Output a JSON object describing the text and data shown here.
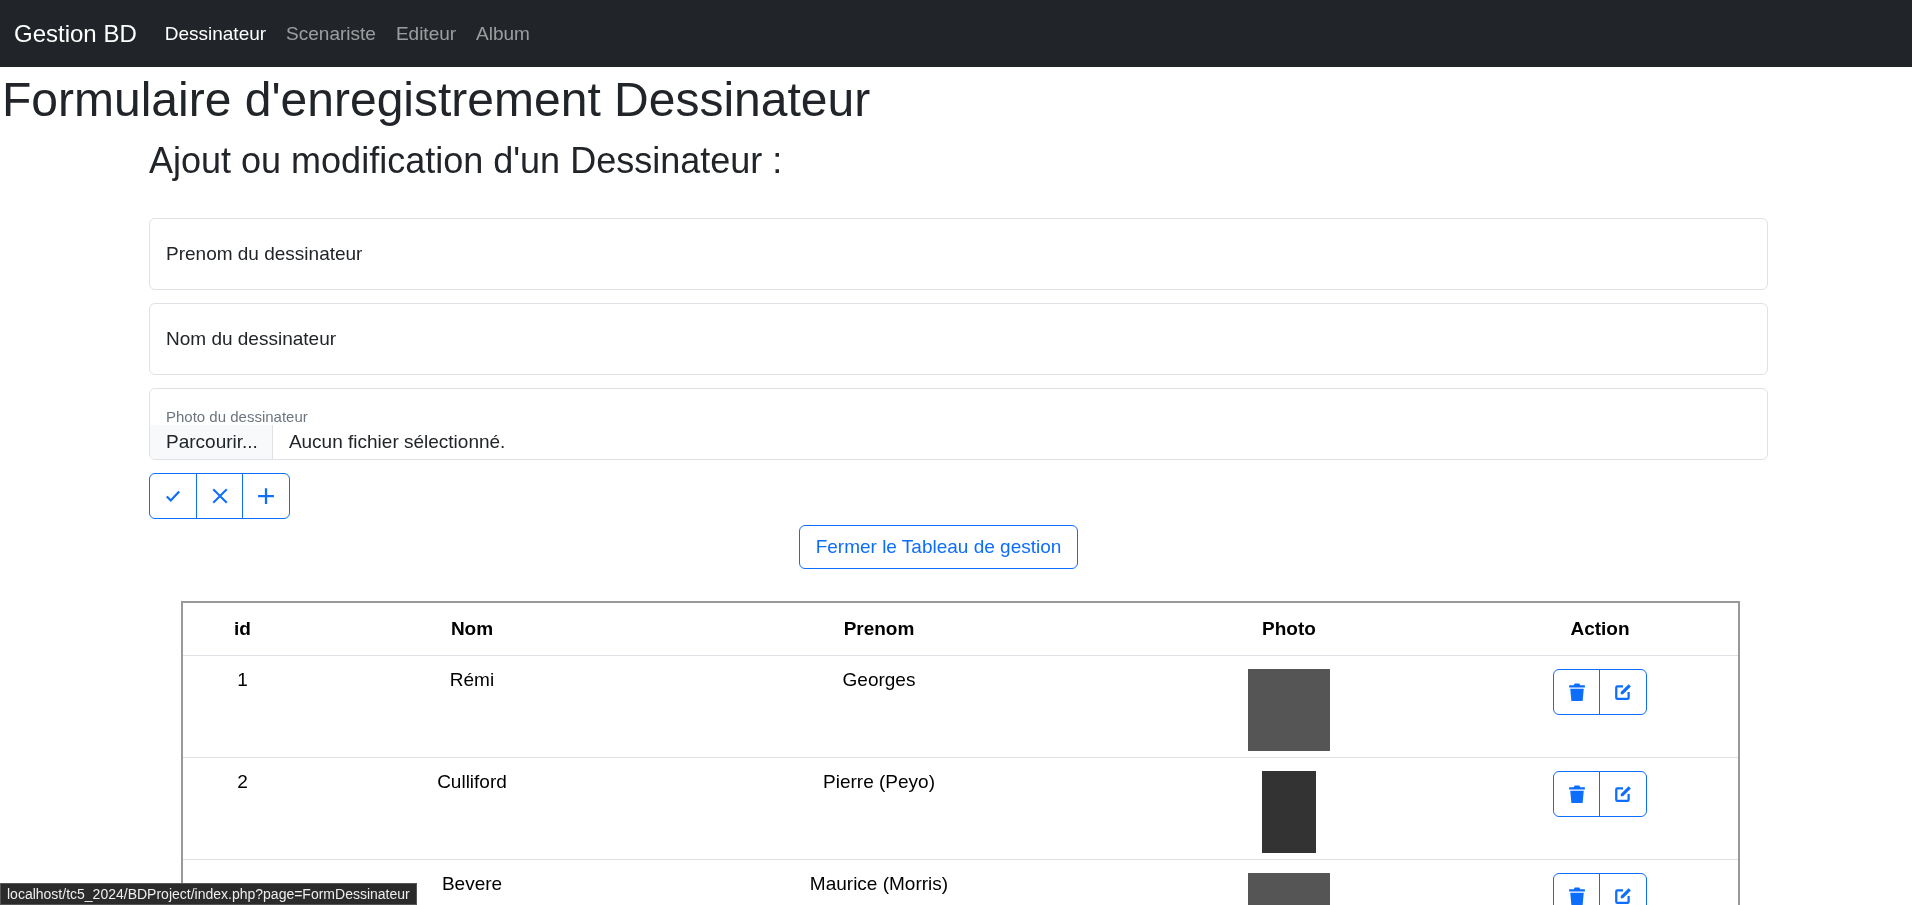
{
  "navbar": {
    "brand": "Gestion BD",
    "items": [
      {
        "label": "Dessinateur",
        "selected": true
      },
      {
        "label": "Scenariste",
        "selected": false
      },
      {
        "label": "Editeur",
        "selected": false
      },
      {
        "label": "Album",
        "selected": false
      }
    ]
  },
  "page_title": "Formulaire d'enregistrement Dessinateur",
  "form": {
    "heading": "Ajout ou modification d'un Dessinateur :",
    "fields": [
      {
        "placeholder": "Prenom du dessinateur"
      },
      {
        "placeholder": "Nom du dessinateur"
      }
    ],
    "file_field": {
      "label": "Photo du dessinateur",
      "button": "Parcourir...",
      "value": "Aucun fichier sélectionné."
    }
  },
  "toggle_button": "Fermer le Tableau de gestion",
  "table": {
    "columns": [
      "id",
      "Nom",
      "Prenom",
      "Photo",
      "Action"
    ],
    "rows": [
      {
        "id": "1",
        "nom": "Rémi",
        "prenom": "Georges"
      },
      {
        "id": "2",
        "nom": "Culliford",
        "prenom": "Pierre (Peyo)"
      },
      {
        "nom": "Bevere",
        "prenom": "Maurice (Morris)"
      }
    ]
  },
  "status_bar": "localhost/tc5_2024/BDProject/index.php?page=FormDessinateur"
}
